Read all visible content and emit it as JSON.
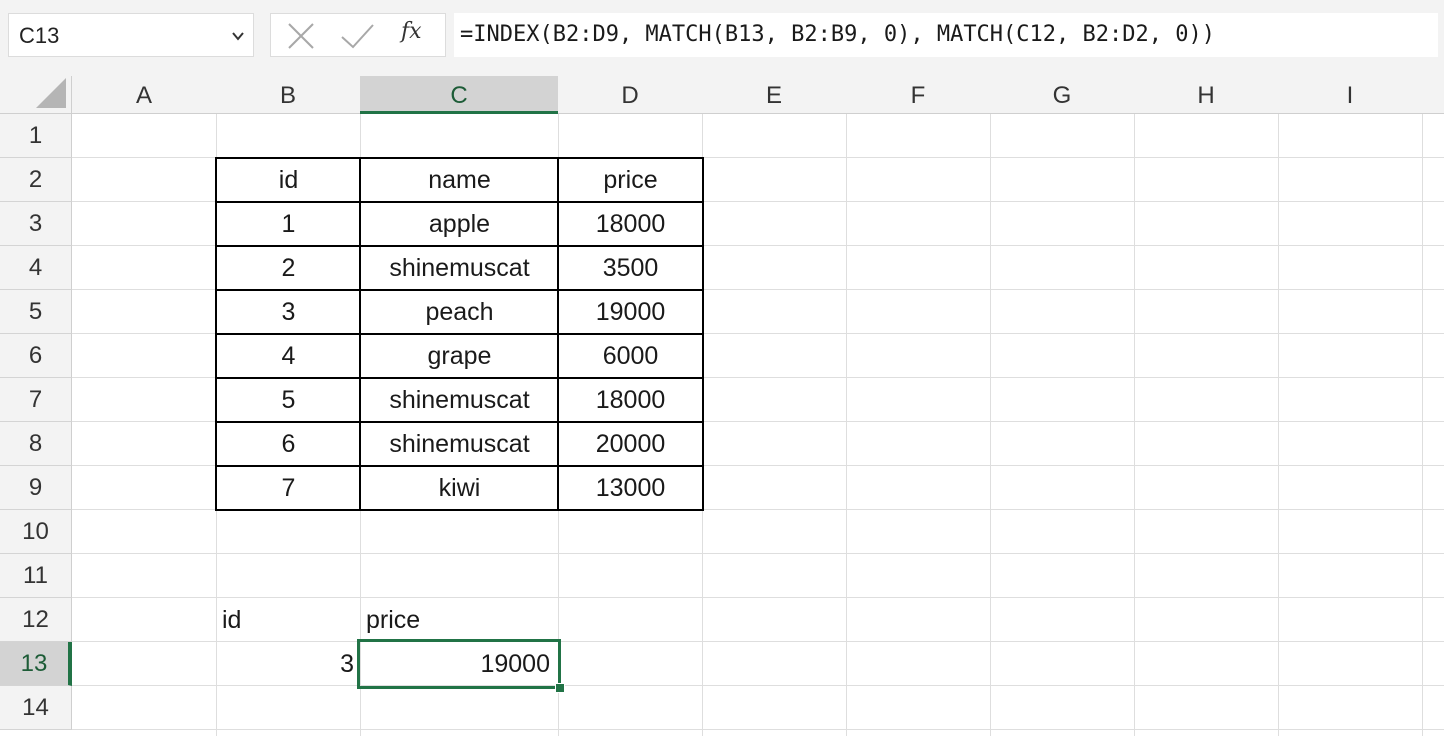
{
  "name_box": {
    "value": "C13"
  },
  "formula_bar": {
    "fx_label": "fx",
    "formula": "=INDEX(B2:D9, MATCH(B13, B2:B9, 0), MATCH(C12, B2:D2, 0))"
  },
  "columns": [
    "A",
    "B",
    "C",
    "D",
    "E",
    "F",
    "G",
    "H",
    "I"
  ],
  "rows": [
    "1",
    "2",
    "3",
    "4",
    "5",
    "6",
    "7",
    "8",
    "9",
    "10",
    "11",
    "12",
    "13",
    "14"
  ],
  "selected": {
    "column": "C",
    "row": "13"
  },
  "accent_color": "#217346",
  "table": {
    "headers": [
      "id",
      "name",
      "price"
    ],
    "rows": [
      [
        "1",
        "apple",
        "18000"
      ],
      [
        "2",
        "shinemuscat",
        "3500"
      ],
      [
        "3",
        "peach",
        "19000"
      ],
      [
        "4",
        "grape",
        "6000"
      ],
      [
        "5",
        "shinemuscat",
        "18000"
      ],
      [
        "6",
        "shinemuscat",
        "20000"
      ],
      [
        "7",
        "kiwi",
        "13000"
      ]
    ]
  },
  "lookup": {
    "id_label": "id",
    "price_label": "price",
    "id_value": "3",
    "price_value": "19000"
  }
}
